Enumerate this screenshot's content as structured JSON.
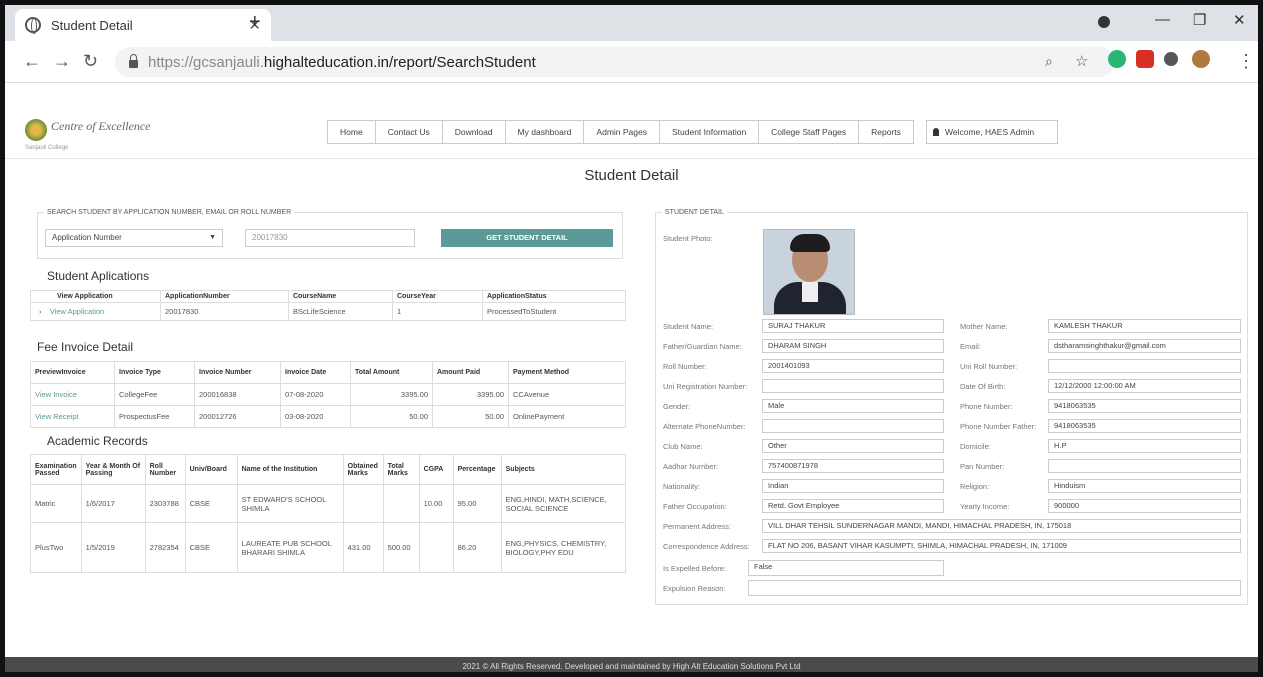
{
  "browser": {
    "tab_title": "Student Detail",
    "url_host": "https://gcsanjauli.",
    "url_rest": "highalteducation.in/report/SearchStudent"
  },
  "site": {
    "logo_text": "Centre of Excellence",
    "logo_sub": "Sanjauli College",
    "menu": [
      "Home",
      "Contact Us",
      "Download",
      "My dashboard",
      "Admin Pages",
      "Student Information",
      "College Staff Pages",
      "Reports"
    ],
    "welcome": "Welcome,  HAES  Admin"
  },
  "page_title": "Student Detail",
  "search": {
    "legend": "SEARCH STUDENT BY APPLICATION NUMBER, EMAIL OR ROLL NUMBER",
    "select_value": "Application Number",
    "input_value": "20017830",
    "button_label": "GET STUDENT DETAIL"
  },
  "applications": {
    "title": "Student Aplications",
    "headers": [
      "View Application",
      "ApplicationNumber",
      "CourseName",
      "CourseYear",
      "ApplicationStatus"
    ],
    "rows": [
      [
        "View Application",
        "20017830",
        "BScLifeScience",
        "1",
        "ProcessedToStudent"
      ]
    ]
  },
  "fees": {
    "title": "Fee Invoice Detail",
    "headers": [
      "PreviewInvoice",
      "Invoice Type",
      "Invoice Number",
      "Invoice Date",
      "Total Amount",
      "Amount Paid",
      "Payment Method"
    ],
    "rows": [
      [
        "View Invoice",
        "CollegeFee",
        "200016838",
        "07-08-2020",
        "3395.00",
        "3395.00",
        "CCAvenue"
      ],
      [
        "View Receipt",
        "ProspectusFee",
        "200012726",
        "03-08-2020",
        "50.00",
        "50.00",
        "OnlinePayment"
      ]
    ]
  },
  "academic": {
    "title": "Academic Records",
    "headers": [
      "Examination Passed",
      "Year & Month Of Passing",
      "Roll Number",
      "Univ/Board",
      "Name of the Institution",
      "Obtained Marks",
      "Total Marks",
      "CGPA",
      "Percentage",
      "Subjects"
    ],
    "rows": [
      [
        "Matric",
        "1/6/2017",
        "2303788",
        "CBSE",
        "ST EDWARD'S SCHOOL SHIMLA",
        "",
        "",
        "10.00",
        "95.00",
        "ENG,HINDI, MATH,SCIENCE, SOCIAL SCIENCE"
      ],
      [
        "PlusTwo",
        "1/5/2019",
        "2782354",
        "CBSE",
        "LAUREATE PUB SCHOOL BHARARI SHIMLA",
        "431.00",
        "500.00",
        "",
        "86.20",
        "ENG,PHYSICS, CHEMISTRY, BIOLOGY,PHY EDU"
      ]
    ]
  },
  "detail": {
    "legend": "STUDENT DETAIL",
    "photo_label": "Student Photo:",
    "student_name_label": "Student Name:",
    "student_name": "SURAJ THAKUR",
    "mother_name_label": "Mother Name:",
    "mother_name": "KAMLESH THAKUR",
    "father_name_label": "Father/Guardian Name:",
    "father_name": "DHARAM SINGH",
    "email_label": "Email:",
    "email": "dstharamsinghthakur@gmail.com",
    "roll_label": "Roll Number:",
    "roll": "2001401093",
    "uni_roll_label": "Uni Roll Number:",
    "uni_roll": "",
    "uni_reg_label": "Uni Registration Number:",
    "uni_reg": "",
    "dob_label": "Date Of Birth:",
    "dob": "12/12/2000 12:00:00 AM",
    "gender_label": "Gender:",
    "gender": "Male",
    "phone_label": "Phone Number:",
    "phone": "9418063535",
    "alt_phone_label": "Alternate PhoneNumber:",
    "alt_phone": "",
    "father_phone_label": "Phone Number Father:",
    "father_phone": "9418063535",
    "club_label": "Club Name:",
    "club": "Other",
    "domicile_label": "Domicile:",
    "domicile": "H.P",
    "aadhar_label": "Aadhar Number:",
    "aadhar": "757400871978",
    "pan_label": "Pan Number:",
    "pan": "",
    "nationality_label": "Nationality:",
    "nationality": "Indian",
    "religion_label": "Religion:",
    "religion": "Hinduism",
    "father_occ_label": "Father Occupation:",
    "father_occ": "Retd. Govt Employee",
    "income_label": "Yearly Income:",
    "income": "900000",
    "perm_addr_label": "Permanent Address:",
    "perm_addr": "VILL DHAR TEHSIL SUNDERNAGAR MANDI, MANDI, HIMACHAL PRADESH, IN, 175018",
    "corr_addr_label": "Correspondence Address:",
    "corr_addr": "FLAT NO 206, BASANT VIHAR KASUMPTI, SHIMLA, HIMACHAL PRADESH, IN, 171009",
    "expelled_label": "Is Expelled Before:",
    "expelled": "False",
    "expulsion_label": "Expulsion Reason:",
    "expulsion": ""
  },
  "footer": "2021 © All Rights Reserved. Developed and maintained by High Alt Education Solutions Pvt Ltd"
}
